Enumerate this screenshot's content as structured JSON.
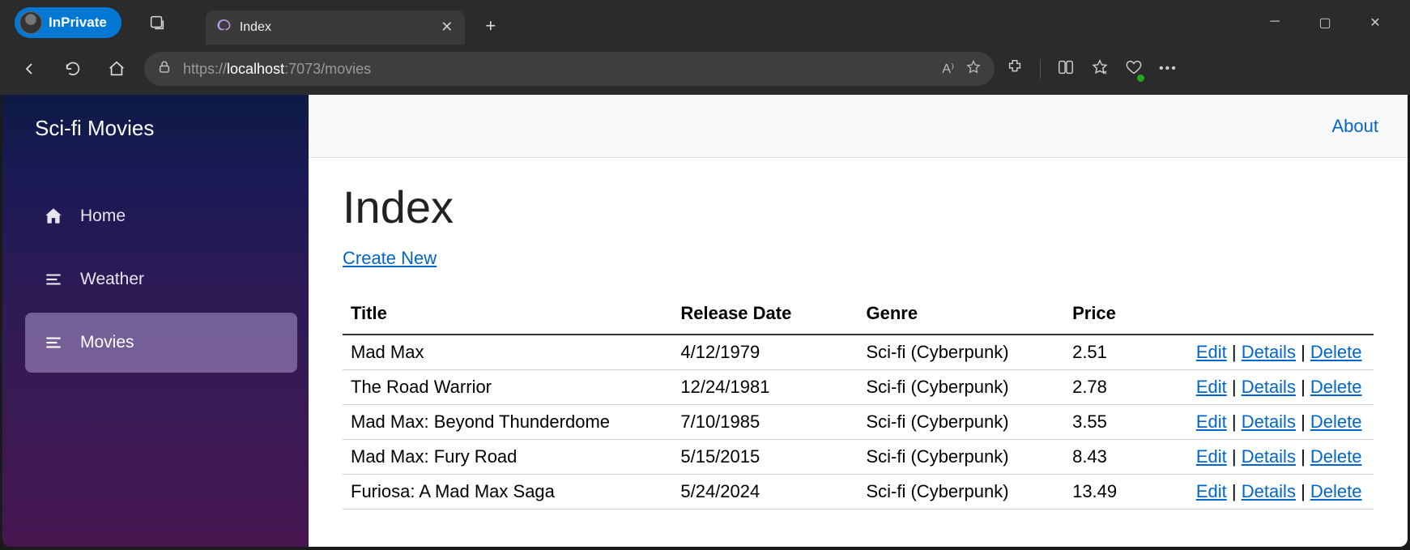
{
  "browser": {
    "inprivate_label": "InPrivate",
    "tab_title": "Index",
    "url_prefix": "https://",
    "url_host": "localhost",
    "url_suffix": ":7073/movies"
  },
  "sidebar": {
    "brand": "Sci-fi Movies",
    "items": [
      {
        "label": "Home",
        "icon": "home",
        "active": false
      },
      {
        "label": "Weather",
        "icon": "list",
        "active": false
      },
      {
        "label": "Movies",
        "icon": "list",
        "active": true
      }
    ]
  },
  "topbar": {
    "about_label": "About"
  },
  "page": {
    "heading": "Index",
    "create_label": "Create New",
    "columns": {
      "title": "Title",
      "release": "Release Date",
      "genre": "Genre",
      "price": "Price"
    },
    "rows": [
      {
        "title": "Mad Max",
        "release": "4/12/1979",
        "genre": "Sci-fi (Cyberpunk)",
        "price": "2.51"
      },
      {
        "title": "The Road Warrior",
        "release": "12/24/1981",
        "genre": "Sci-fi (Cyberpunk)",
        "price": "2.78"
      },
      {
        "title": "Mad Max: Beyond Thunderdome",
        "release": "7/10/1985",
        "genre": "Sci-fi (Cyberpunk)",
        "price": "3.55"
      },
      {
        "title": "Mad Max: Fury Road",
        "release": "5/15/2015",
        "genre": "Sci-fi (Cyberpunk)",
        "price": "8.43"
      },
      {
        "title": "Furiosa: A Mad Max Saga",
        "release": "5/24/2024",
        "genre": "Sci-fi (Cyberpunk)",
        "price": "13.49"
      }
    ],
    "actions": {
      "edit": "Edit",
      "details": "Details",
      "delete": "Delete"
    }
  }
}
